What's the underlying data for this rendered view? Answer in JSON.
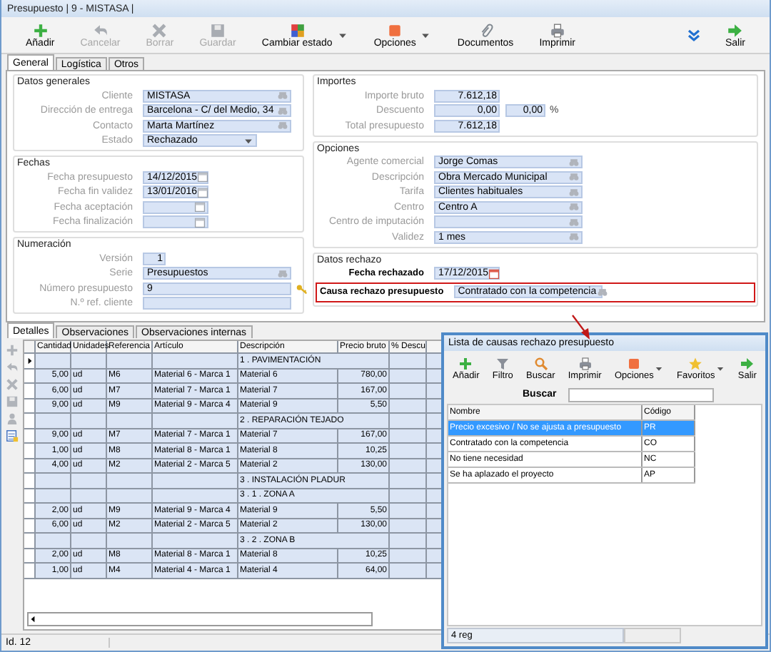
{
  "window": {
    "title": "Presupuesto | 9 - MISTASA |"
  },
  "toolbar": [
    {
      "label": "Añadir",
      "disabled": false,
      "dropdown": false
    },
    {
      "label": "Cancelar",
      "disabled": true,
      "dropdown": false
    },
    {
      "label": "Borrar",
      "disabled": true,
      "dropdown": false
    },
    {
      "label": "Guardar",
      "disabled": true,
      "dropdown": false
    },
    {
      "label": "Cambiar estado",
      "disabled": false,
      "dropdown": true
    },
    {
      "label": "Opciones",
      "disabled": false,
      "dropdown": true
    },
    {
      "label": "Documentos",
      "disabled": false,
      "dropdown": false
    },
    {
      "label": "Imprimir",
      "disabled": false,
      "dropdown": false
    }
  ],
  "toolbar_right": [
    {
      "label": "Salir",
      "disabled": false,
      "dropdown": false
    }
  ],
  "tabs": [
    {
      "label": "General",
      "selected": true
    },
    {
      "label": "Logística",
      "selected": false
    },
    {
      "label": "Otros",
      "selected": false
    }
  ],
  "left_groups": [
    {
      "title": "Datos generales",
      "emphasis": false,
      "fields": [
        {
          "label": "Cliente",
          "kind": "lookup",
          "value": "MISTASA"
        },
        {
          "label": "Dirección de entrega",
          "kind": "lookup",
          "value": "Barcelona - C/ del Medio, 34"
        },
        {
          "label": "Contacto",
          "kind": "lookup",
          "value": "Marta Martínez"
        },
        {
          "label": "Estado",
          "kind": "select",
          "value": "Rechazado"
        }
      ]
    },
    {
      "title": "Fechas",
      "emphasis": false,
      "fields": [
        {
          "label": "Fecha presupuesto",
          "kind": "date",
          "value": "14/12/2015"
        },
        {
          "label": "Fecha fin validez",
          "kind": "date",
          "value": "13/01/2016"
        },
        {
          "label": "Fecha aceptación",
          "kind": "date"
        },
        {
          "label": "Fecha finalización",
          "kind": "date"
        }
      ]
    },
    {
      "title": "Numeración",
      "emphasis": false,
      "fields": [
        {
          "label": "Versión",
          "kind": "short",
          "value": "1"
        },
        {
          "label": "Serie",
          "kind": "lookup",
          "value": "Presupuestos"
        },
        {
          "label": "Número presupuesto",
          "kind": "key",
          "value": "9"
        },
        {
          "label": "N.º ref. cliente",
          "kind": "text"
        }
      ]
    }
  ],
  "right_groups": [
    {
      "title": "Importes",
      "emphasis": false,
      "fields": [
        {
          "label": "Importe bruto",
          "kind": "amount",
          "value": "7.612,18"
        },
        {
          "label": "Descuento",
          "kind": "amount",
          "value": "0,00",
          "extra": "0,00",
          "unit": "%"
        },
        {
          "label": "Total presupuesto",
          "kind": "amount",
          "value": "7.612,18"
        }
      ]
    },
    {
      "title": "Opciones",
      "emphasis": false,
      "fields": [
        {
          "label": "Agente comercial",
          "kind": "lookup",
          "value": "Jorge Comas"
        },
        {
          "label": "Descripción",
          "kind": "lookup",
          "value": "Obra Mercado Municipal"
        },
        {
          "label": "Tarifa",
          "kind": "lookup",
          "value": "Clientes habituales"
        },
        {
          "label": "Centro",
          "kind": "lookup",
          "value": "Centro A"
        },
        {
          "label": "Centro de imputación",
          "kind": "lookup"
        },
        {
          "label": "Validez",
          "kind": "lookup",
          "value": "1 mes"
        }
      ]
    },
    {
      "title": "Datos rechazo",
      "emphasis": true,
      "fields": [
        {
          "label": "Fecha rechazado",
          "kind": "date",
          "value": "17/12/2015",
          "highlighted": false
        },
        {
          "label": "Causa rechazo presupuesto",
          "kind": "lookup",
          "value": "Contratado con la competencia",
          "highlighted": true
        }
      ]
    }
  ],
  "detail_tabs": [
    {
      "label": "Detalles",
      "selected": true
    },
    {
      "label": "Observaciones",
      "selected": false
    },
    {
      "label": "Observaciones internas",
      "selected": false
    }
  ],
  "grid": {
    "columns": [
      "Cantidad",
      "Unidades",
      "Referencia",
      "Artículo",
      "Descripción",
      "Precio bruto",
      "% Descu"
    ],
    "rows": [
      {
        "current": true,
        "description": "1 . PAVIMENTACIÓN"
      },
      {
        "current": false,
        "qty": "5,00",
        "unit": "ud",
        "ref": "M6",
        "article": "Material 6 - Marca 1",
        "description": "Material 6",
        "price": "780,00"
      },
      {
        "current": false,
        "qty": "6,00",
        "unit": "ud",
        "ref": "M7",
        "article": "Material 7 - Marca 1",
        "description": "Material 7",
        "price": "167,00"
      },
      {
        "current": false,
        "qty": "9,00",
        "unit": "ud",
        "ref": "M9",
        "article": "Material 9 - Marca 4",
        "description": "Material 9",
        "price": "5,50"
      },
      {
        "current": false,
        "description": "2 . REPARACIÓN TEJADO"
      },
      {
        "current": false,
        "qty": "9,00",
        "unit": "ud",
        "ref": "M7",
        "article": "Material 7 - Marca 1",
        "description": "Material 7",
        "price": "167,00"
      },
      {
        "current": false,
        "qty": "1,00",
        "unit": "ud",
        "ref": "M8",
        "article": "Material 8 - Marca 1",
        "description": "Material 8",
        "price": "10,25"
      },
      {
        "current": false,
        "qty": "4,00",
        "unit": "ud",
        "ref": "M2",
        "article": "Material 2 - Marca 5",
        "description": "Material 2",
        "price": "130,00"
      },
      {
        "current": false,
        "description": "3 . INSTALACIÓN PLADUR"
      },
      {
        "current": false,
        "description": "3 . 1 . ZONA A"
      },
      {
        "current": false,
        "qty": "2,00",
        "unit": "ud",
        "ref": "M9",
        "article": "Material 9 - Marca 4",
        "description": "Material 9",
        "price": "5,50"
      },
      {
        "current": false,
        "qty": "6,00",
        "unit": "ud",
        "ref": "M2",
        "article": "Material 2 - Marca 5",
        "description": "Material 2",
        "price": "130,00"
      },
      {
        "current": false,
        "description": "3 . 2 . ZONA B"
      },
      {
        "current": false,
        "qty": "2,00",
        "unit": "ud",
        "ref": "M8",
        "article": "Material 8 - Marca 1",
        "description": "Material 8",
        "price": "10,25"
      },
      {
        "current": false,
        "qty": "1,00",
        "unit": "ud",
        "ref": "M4",
        "article": "Material 4 - Marca 1",
        "description": "Material 4",
        "price": "64,00"
      }
    ]
  },
  "status_bar": {
    "text": "Id. 12"
  },
  "popup": {
    "title": "Lista de causas rechazo presupuesto",
    "toolbar": [
      {
        "label": "Añadir",
        "dropdown": false
      },
      {
        "label": "Filtro",
        "dropdown": false
      },
      {
        "label": "Buscar",
        "dropdown": false
      },
      {
        "label": "Imprimir",
        "dropdown": false
      },
      {
        "label": "Opciones",
        "dropdown": true
      },
      {
        "label": "Favoritos",
        "dropdown": true
      },
      {
        "label": "Salir",
        "dropdown": false
      }
    ],
    "search_label": "Buscar",
    "columns": [
      "Nombre",
      "Código"
    ],
    "rows": [
      {
        "name": "Precio excesivo / No se ajusta a presupuesto",
        "code": "PR",
        "selected": true
      },
      {
        "name": "Contratado con la competencia",
        "code": "CO",
        "selected": false
      },
      {
        "name": "No tiene necesidad",
        "code": "NC",
        "selected": false
      },
      {
        "name": "Se ha aplazado el proyecto",
        "code": "AP",
        "selected": false
      }
    ],
    "footer": "4 reg"
  }
}
